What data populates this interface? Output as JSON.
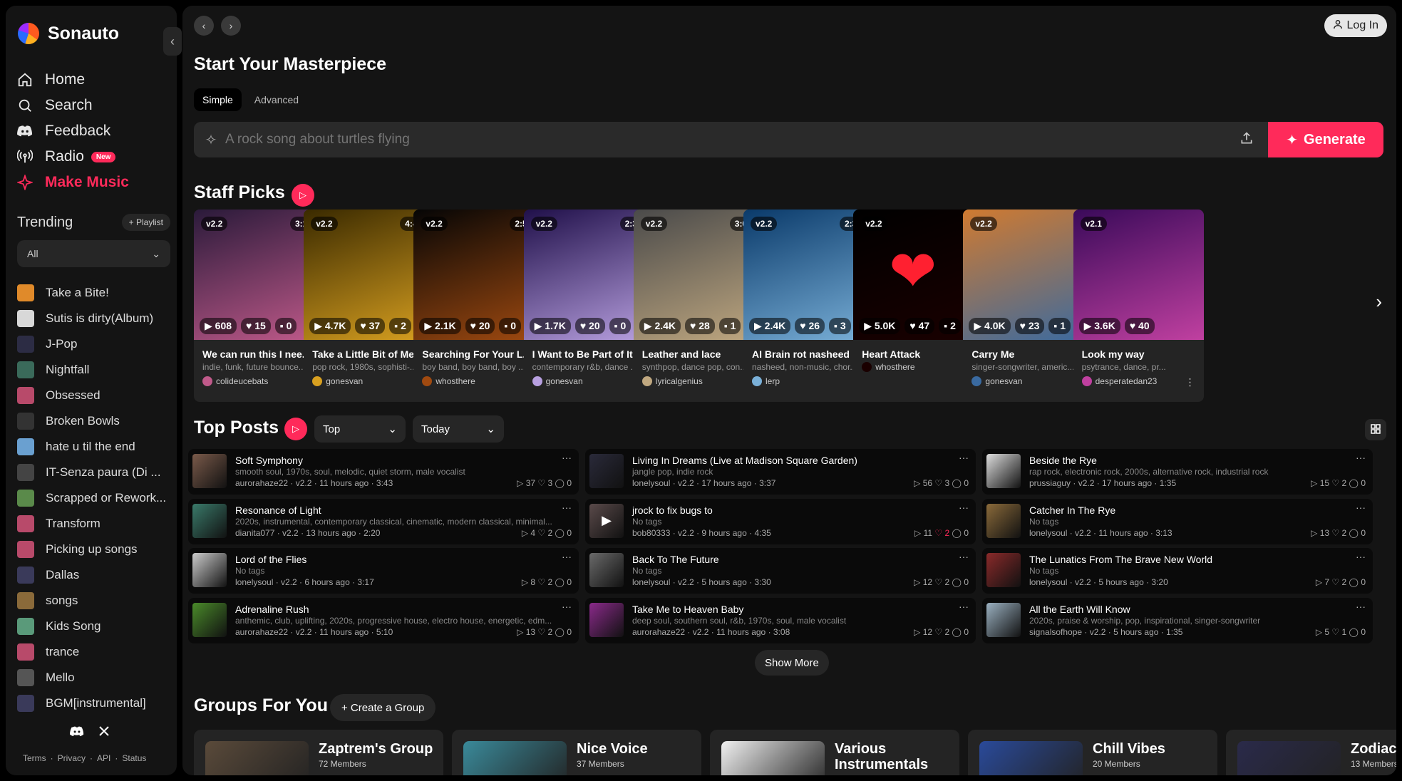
{
  "brand": {
    "name": "Sonauto"
  },
  "nav": [
    {
      "label": "Home",
      "icon": "home-icon"
    },
    {
      "label": "Search",
      "icon": "search-icon"
    },
    {
      "label": "Feedback",
      "icon": "discord-icon"
    },
    {
      "label": "Radio",
      "icon": "radio-icon",
      "badge": "New"
    },
    {
      "label": "Make Music",
      "icon": "sparkle-icon",
      "active": true
    }
  ],
  "trending": {
    "title": "Trending",
    "playlist_button": "+ Playlist",
    "filter": "All",
    "items": [
      {
        "label": "Take a Bite!",
        "color": "#e08a2a"
      },
      {
        "label": "Sutis is dirty(Album)",
        "color": "#d8d8d8"
      },
      {
        "label": "J-Pop",
        "color": "#2c2c44"
      },
      {
        "label": "Nightfall",
        "color": "#3a6a5a"
      },
      {
        "label": "Obsessed",
        "color": "#b84a6a"
      },
      {
        "label": "Broken Bowls",
        "color": "#333333"
      },
      {
        "label": "hate u til the end",
        "color": "#6aa0d0"
      },
      {
        "label": "IT-Senza paura (Di ...",
        "color": "#444444"
      },
      {
        "label": "Scrapped or Rework...",
        "color": "#5a8a4a"
      },
      {
        "label": "Transform",
        "color": "#b84a6a"
      },
      {
        "label": "Picking up songs",
        "color": "#b84a6a"
      },
      {
        "label": "Dallas",
        "color": "#3a3a5a"
      },
      {
        "label": "songs",
        "color": "#8a6a3a"
      },
      {
        "label": "Kids Song",
        "color": "#5a9a7a"
      },
      {
        "label": "trance",
        "color": "#b84a6a"
      },
      {
        "label": "Mello",
        "color": "#555555"
      },
      {
        "label": "BGM[instrumental]",
        "color": "#3a3a5a"
      }
    ]
  },
  "footer_links": [
    "Terms",
    "·",
    "Privacy",
    "·",
    "API",
    "·",
    "Status"
  ],
  "header": {
    "login": "Log In"
  },
  "composer": {
    "title": "Start Your Masterpiece",
    "tabs": [
      "Simple",
      "Advanced"
    ],
    "placeholder": "A rock song about turtles flying",
    "generate": "Generate"
  },
  "staff_picks": {
    "title": "Staff Picks",
    "cards": [
      {
        "version": "v2.2",
        "duration": "3:18",
        "plays": "608",
        "likes": "15",
        "comments": "0",
        "title": "We can run this I nee...",
        "tags": "indie, funk, future bounce...",
        "user": "colideucebats",
        "art": [
          "#2a1a3a",
          "#c05a8a"
        ]
      },
      {
        "version": "v2.2",
        "duration": "4:46",
        "plays": "4.7K",
        "likes": "37",
        "comments": "2",
        "title": "Take a Little Bit of Me",
        "tags": "pop rock, 1980s, sophisti-...",
        "user": "gonesvan",
        "art": [
          "#3a2a00",
          "#d8a020"
        ]
      },
      {
        "version": "v2.2",
        "duration": "2:56",
        "plays": "2.1K",
        "likes": "20",
        "comments": "0",
        "title": "Searching For Your L...",
        "tags": "boy band, boy band, boy ...",
        "user": "whosthere",
        "art": [
          "#050505",
          "#a04a10"
        ]
      },
      {
        "version": "v2.2",
        "duration": "2:32",
        "plays": "1.7K",
        "likes": "20",
        "comments": "0",
        "title": "I Want to Be Part of It",
        "tags": "contemporary r&b, dance ...",
        "user": "gonesvan",
        "art": [
          "#20104a",
          "#b8a0e0"
        ]
      },
      {
        "version": "v2.2",
        "duration": "3:08",
        "plays": "2.4K",
        "likes": "28",
        "comments": "1",
        "title": "Leather and lace",
        "tags": "synthpop, dance pop, con...",
        "user": "lyricalgenius",
        "art": [
          "#4a4a4a",
          "#c0a880"
        ]
      },
      {
        "version": "v2.2",
        "duration": "2:35",
        "plays": "2.4K",
        "likes": "26",
        "comments": "3",
        "title": "AI Brain rot nasheed",
        "tags": "nasheed, non-music, chor...",
        "user": "lerp",
        "art": [
          "#0a3a6a",
          "#7ab0d8"
        ]
      },
      {
        "version": "v2.2",
        "duration": "",
        "plays": "5.0K",
        "likes": "47",
        "comments": "2",
        "title": "Heart Attack",
        "tags": "",
        "user": "whosthere",
        "art": [
          "#000000",
          "#1a0000"
        ]
      },
      {
        "version": "v2.2",
        "duration": "",
        "plays": "4.0K",
        "likes": "23",
        "comments": "1",
        "title": "Carry Me",
        "tags": "singer-songwriter, americ...",
        "user": "gonesvan",
        "art": [
          "#d07a30",
          "#3a6aa0"
        ]
      },
      {
        "version": "v2.1",
        "duration": "",
        "plays": "3.6K",
        "likes": "40",
        "comments": "",
        "title": "Look my way",
        "tags": "psytrance, dance, pr...",
        "user": "desperatedan23",
        "art": [
          "#3a0a5a",
          "#c040a0"
        ]
      }
    ]
  },
  "top_posts": {
    "title": "Top Posts",
    "sort": "Top",
    "range": "Today",
    "show_more": "Show More",
    "posts": [
      {
        "title": "Soft Symphony",
        "tags": "smooth soul, 1970s, soul, melodic, quiet storm, male vocalist",
        "meta": "aurorahaze22 · v2.2 · 11 hours ago · 3:43",
        "plays": "37",
        "likes": "3",
        "comments": "0",
        "color": "#7a5a4a"
      },
      {
        "title": "Living In Dreams (Live at Madison Square Garden)",
        "tags": "jangle pop, indie rock",
        "meta": "lonelysoul · v2.2 · 17 hours ago · 3:37",
        "plays": "56",
        "likes": "3",
        "comments": "0",
        "color": "#2a2a3a"
      },
      {
        "title": "Beside the Rye",
        "tags": "rap rock, electronic rock, 2000s, alternative rock, industrial rock",
        "meta": "prussiaguy · v2.2 · 17 hours ago · 1:35",
        "plays": "15",
        "likes": "2",
        "comments": "0",
        "color": "#dddddd"
      },
      {
        "title": "Resonance of Light",
        "tags": "2020s, instrumental, contemporary classical, cinematic, modern classical, minimal...",
        "meta": "dianita077 · v2.2 · 13 hours ago · 2:20",
        "plays": "4",
        "likes": "2",
        "comments": "0",
        "color": "#3a7a6a"
      },
      {
        "title": "jrock to fix bugs to",
        "tags": "No tags",
        "meta": "bob80333 · v2.2 · 9 hours ago · 4:35",
        "plays": "11",
        "likes": "2",
        "comments": "0",
        "color": "#5a4a4a",
        "liked": true,
        "playing": true
      },
      {
        "title": "Catcher In The Rye",
        "tags": "No tags",
        "meta": "lonelysoul · v2.2 · 11 hours ago · 3:13",
        "plays": "13",
        "likes": "2",
        "comments": "0",
        "color": "#8a6a3a"
      },
      {
        "title": "Lord of the Flies",
        "tags": "No tags",
        "meta": "lonelysoul · v2.2 · 6 hours ago · 3:17",
        "plays": "8",
        "likes": "2",
        "comments": "0",
        "color": "#cccccc"
      },
      {
        "title": "Back To The Future",
        "tags": "No tags",
        "meta": "lonelysoul · v2.2 · 5 hours ago · 3:30",
        "plays": "12",
        "likes": "2",
        "comments": "0",
        "color": "#6a6a6a"
      },
      {
        "title": "The Lunatics From The Brave New World",
        "tags": "No tags",
        "meta": "lonelysoul · v2.2 · 5 hours ago · 3:20",
        "plays": "7",
        "likes": "2",
        "comments": "0",
        "color": "#8a2a2a"
      },
      {
        "title": "Adrenaline Rush",
        "tags": "anthemic, club, uplifting, 2020s, progressive house, electro house, energetic, edm...",
        "meta": "aurorahaze22 · v2.2 · 11 hours ago · 5:10",
        "plays": "13",
        "likes": "2",
        "comments": "0",
        "color": "#4a8a2a"
      },
      {
        "title": "Take Me to Heaven Baby",
        "tags": "deep soul, southern soul, r&b, 1970s, soul, male vocalist",
        "meta": "aurorahaze22 · v2.2 · 11 hours ago · 3:08",
        "plays": "12",
        "likes": "2",
        "comments": "0",
        "color": "#8a2a8a"
      },
      {
        "title": "All the Earth Will Know",
        "tags": "2020s, praise & worship, pop, inspirational, singer-songwriter",
        "meta": "signalsofhope · v2.2 · 5 hours ago · 1:35",
        "plays": "5",
        "likes": "1",
        "comments": "0",
        "color": "#9ab0c0"
      }
    ]
  },
  "groups": {
    "title": "Groups For You",
    "create": "+ Create a Group",
    "items": [
      {
        "name": "Zaptrem's Group",
        "members": "72 Members",
        "color": "#5a4a3a"
      },
      {
        "name": "Nice Voice",
        "members": "37 Members",
        "color": "#3a8a9a"
      },
      {
        "name": "Various Instrumentals",
        "members": "",
        "color": "#f0f0f0"
      },
      {
        "name": "Chill Vibes",
        "members": "20 Members",
        "color": "#2a4a9a"
      },
      {
        "name": "Zodiac",
        "members": "13 Members",
        "color": "#2a2a4a"
      }
    ]
  }
}
